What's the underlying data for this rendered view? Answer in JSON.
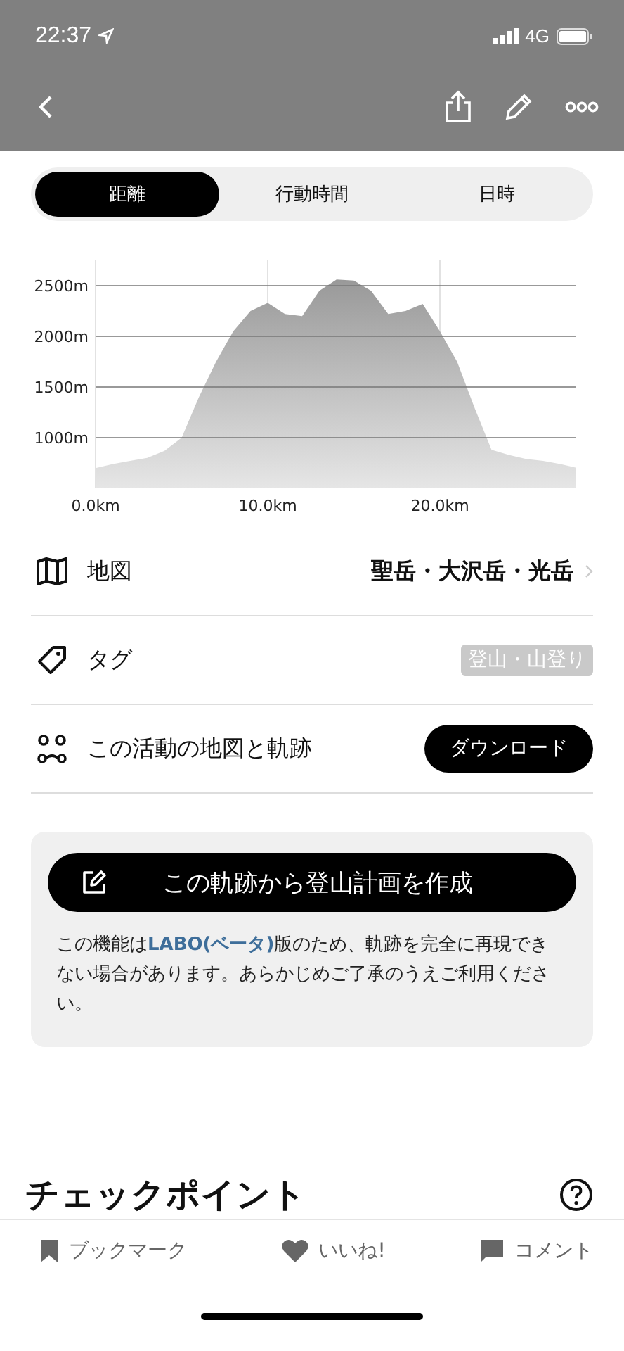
{
  "status_bar": {
    "time": "22:37",
    "network": "4G"
  },
  "segments": [
    {
      "label": "距離",
      "selected": true
    },
    {
      "label": "行動時間",
      "selected": false
    },
    {
      "label": "日時",
      "selected": false
    }
  ],
  "elevation": {
    "chart_data": {
      "type": "area",
      "x": [
        0,
        1,
        2,
        3,
        4,
        5,
        6,
        7,
        8,
        9,
        10,
        11,
        12,
        13,
        14,
        15,
        16,
        17,
        18,
        19,
        20,
        21,
        22,
        23,
        24,
        25,
        26,
        27,
        28
      ],
      "grid": true,
      "series": [
        {
          "color": "#999999",
          "values": [
            700,
            740,
            770,
            800,
            870,
            1000,
            1400,
            1750,
            2050,
            2250,
            2330,
            2220,
            2200,
            2450,
            2560,
            2550,
            2450,
            2220,
            2250,
            2320,
            2050,
            1750,
            1300,
            880,
            830,
            790,
            770,
            740,
            700
          ]
        }
      ],
      "xlim": [
        0,
        28
      ],
      "ylim": [
        500,
        2750
      ],
      "xticks": [
        {
          "value": 0,
          "label": "0.0km"
        },
        {
          "value": 10,
          "label": "10.0km"
        },
        {
          "value": 20,
          "label": "20.0km"
        }
      ],
      "yticks": [
        {
          "value": 1000,
          "label": "1000m"
        },
        {
          "value": 1500,
          "label": "1500m"
        },
        {
          "value": 2000,
          "label": "2000m"
        },
        {
          "value": 2500,
          "label": "2500m"
        }
      ]
    }
  },
  "rows": [
    {
      "kind": "link",
      "label": "地図",
      "value": "聖岳・大沢岳・光岳"
    },
    {
      "kind": "tags",
      "label": "タグ",
      "value": "登山・山登り"
    },
    {
      "kind": "action",
      "label": "この活動の地図と軌跡",
      "value": "ダウンロード"
    }
  ],
  "plan_card": {
    "button": "この軌跡から登山計画を作成",
    "notice_before": "この機能は",
    "notice_link": "LABO(ベータ)",
    "notice_after": "版のため、軌跡を完全に再現できない場合があります。あらかじめご了承のうえご利用ください。"
  },
  "checkpoint": {
    "title": "チェックポイント"
  },
  "bottom_bar": [
    {
      "kind": "bookmark",
      "label": "ブックマーク"
    },
    {
      "kind": "like",
      "label": "いいね!"
    },
    {
      "kind": "comment",
      "label": "コメント"
    }
  ]
}
